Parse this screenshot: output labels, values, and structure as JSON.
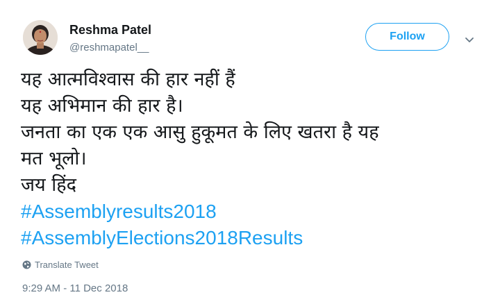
{
  "author": {
    "name": "Reshma Patel",
    "handle": "@reshmapatel__"
  },
  "follow_label": "Follow",
  "tweet": {
    "lines": [
      "यह आत्मविश्वास की हार नहीं हैं",
      "यह अभिमान की हार है।",
      "जनता का एक एक आसु हुकूमत के लिए खतरा है यह",
      "मत भूलो।",
      "जय हिंद"
    ],
    "hashtags": [
      "#Assemblyresults2018",
      "#AssemblyElections2018Results"
    ]
  },
  "translate_label": "Translate Tweet",
  "timestamp": "9:29 AM - 11 Dec 2018",
  "colors": {
    "link": "#1da1f2",
    "secondary_text": "#657786",
    "primary_text": "#14171a"
  },
  "icons": {
    "caret": "chevron-down-icon",
    "translate": "globe-icon"
  }
}
